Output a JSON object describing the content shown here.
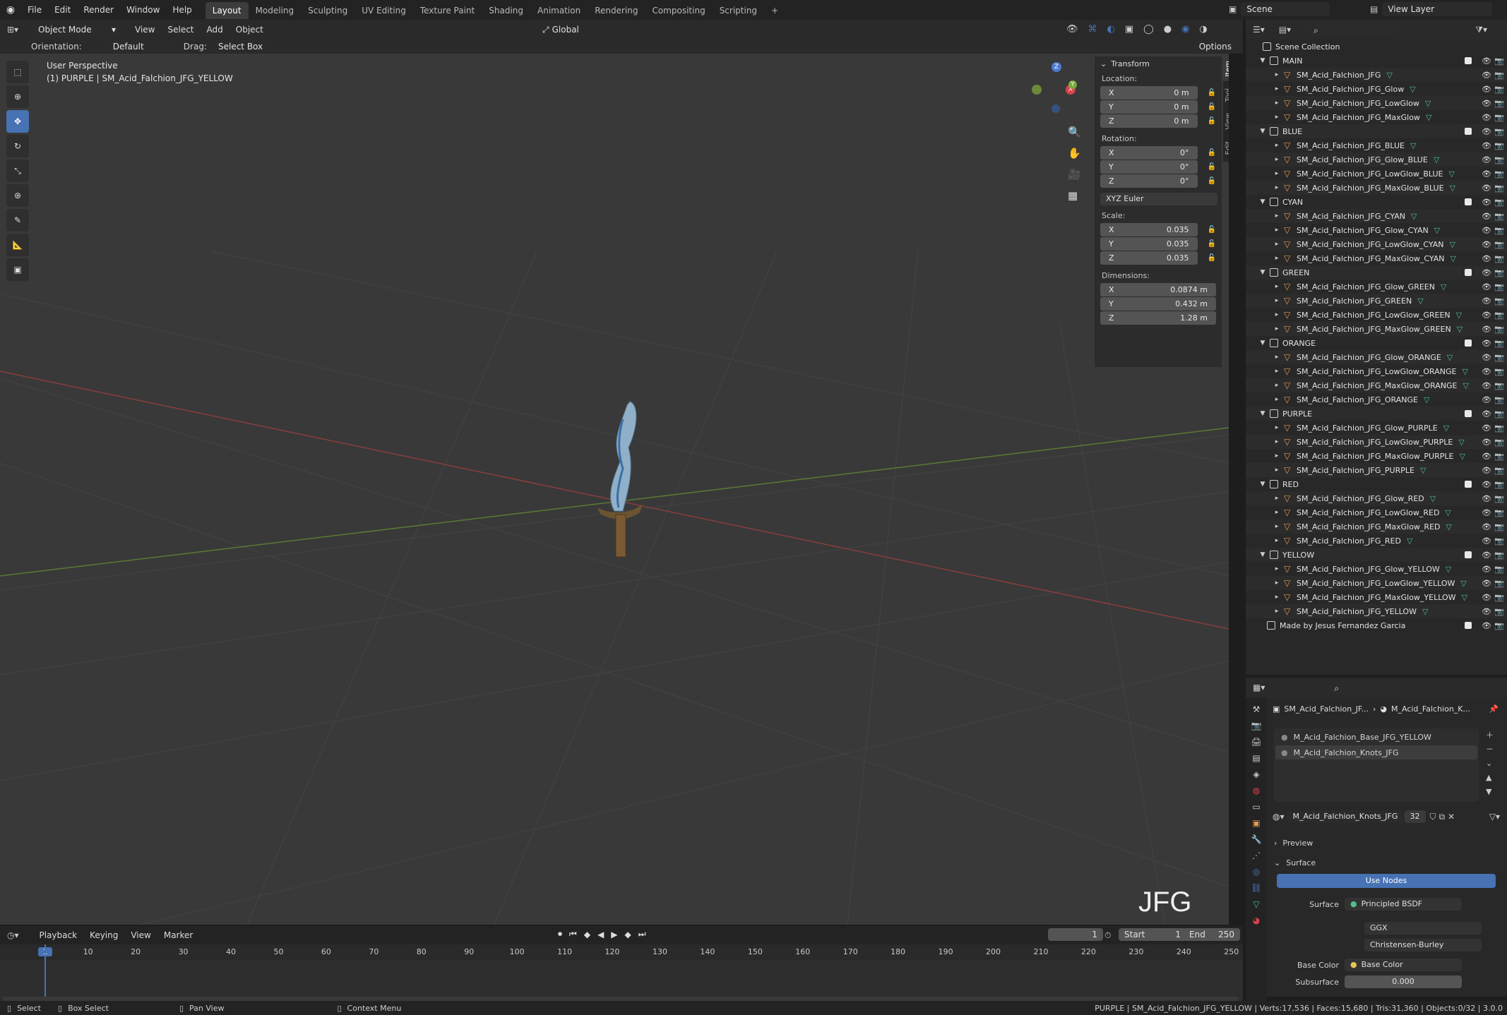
{
  "topbar": {
    "menus": [
      "File",
      "Edit",
      "Render",
      "Window",
      "Help"
    ],
    "workspaces": [
      "Layout",
      "Modeling",
      "Sculpting",
      "UV Editing",
      "Texture Paint",
      "Shading",
      "Animation",
      "Rendering",
      "Compositing",
      "Scripting"
    ],
    "active_workspace": "Layout",
    "add_tab": "+",
    "scene": "Scene",
    "view_layer": "View Layer"
  },
  "viewport_header": {
    "mode": "Object Mode",
    "menus": [
      "View",
      "Select",
      "Add",
      "Object"
    ],
    "transform_orientation": "Global",
    "orientation_label": "Orientation:",
    "orientation_value": "Default",
    "drag_label": "Drag:",
    "drag_value": "Select Box",
    "options": "Options"
  },
  "viewport": {
    "perspective": "User Perspective",
    "object_info": "(1) PURPLE | SM_Acid_Falchion_JFG_YELLOW",
    "watermark": "JFG"
  },
  "gizmo": {
    "x": "X",
    "y": "Y",
    "z": "Z"
  },
  "npanel": {
    "tabs": [
      "Item",
      "Tool",
      "View",
      "Edit"
    ],
    "title": "Transform",
    "location_label": "Location:",
    "location": [
      {
        "axis": "X",
        "value": "0 m"
      },
      {
        "axis": "Y",
        "value": "0 m"
      },
      {
        "axis": "Z",
        "value": "0 m"
      }
    ],
    "rotation_label": "Rotation:",
    "rotation": [
      {
        "axis": "X",
        "value": "0°"
      },
      {
        "axis": "Y",
        "value": "0°"
      },
      {
        "axis": "Z",
        "value": "0°"
      }
    ],
    "rotation_mode": "XYZ Euler",
    "scale_label": "Scale:",
    "scale": [
      {
        "axis": "X",
        "value": "0.035"
      },
      {
        "axis": "Y",
        "value": "0.035"
      },
      {
        "axis": "Z",
        "value": "0.035"
      }
    ],
    "dimensions_label": "Dimensions:",
    "dimensions": [
      {
        "axis": "X",
        "value": "0.0874 m"
      },
      {
        "axis": "Y",
        "value": "0.432 m"
      },
      {
        "axis": "Z",
        "value": "1.28 m"
      }
    ]
  },
  "outliner": {
    "root": "Scene Collection",
    "collections": [
      {
        "name": "MAIN",
        "items": [
          "SM_Acid_Falchion_JFG",
          "SM_Acid_Falchion_JFG_Glow",
          "SM_Acid_Falchion_JFG_LowGlow",
          "SM_Acid_Falchion_JFG_MaxGlow"
        ]
      },
      {
        "name": "BLUE",
        "items": [
          "SM_Acid_Falchion_JFG_BLUE",
          "SM_Acid_Falchion_JFG_Glow_BLUE",
          "SM_Acid_Falchion_JFG_LowGlow_BLUE",
          "SM_Acid_Falchion_JFG_MaxGlow_BLUE"
        ]
      },
      {
        "name": "CYAN",
        "items": [
          "SM_Acid_Falchion_JFG_CYAN",
          "SM_Acid_Falchion_JFG_Glow_CYAN",
          "SM_Acid_Falchion_JFG_LowGlow_CYAN",
          "SM_Acid_Falchion_JFG_MaxGlow_CYAN"
        ]
      },
      {
        "name": "GREEN",
        "items": [
          "SM_Acid_Falchion_JFG_Glow_GREEN",
          "SM_Acid_Falchion_JFG_GREEN",
          "SM_Acid_Falchion_JFG_LowGlow_GREEN",
          "SM_Acid_Falchion_JFG_MaxGlow_GREEN"
        ]
      },
      {
        "name": "ORANGE",
        "items": [
          "SM_Acid_Falchion_JFG_Glow_ORANGE",
          "SM_Acid_Falchion_JFG_LowGlow_ORANGE",
          "SM_Acid_Falchion_JFG_MaxGlow_ORANGE",
          "SM_Acid_Falchion_JFG_ORANGE"
        ]
      },
      {
        "name": "PURPLE",
        "items": [
          "SM_Acid_Falchion_JFG_Glow_PURPLE",
          "SM_Acid_Falchion_JFG_LowGlow_PURPLE",
          "SM_Acid_Falchion_JFG_MaxGlow_PURPLE",
          "SM_Acid_Falchion_JFG_PURPLE"
        ]
      },
      {
        "name": "RED",
        "items": [
          "SM_Acid_Falchion_JFG_Glow_RED",
          "SM_Acid_Falchion_JFG_LowGlow_RED",
          "SM_Acid_Falchion_JFG_MaxGlow_RED",
          "SM_Acid_Falchion_JFG_RED"
        ]
      },
      {
        "name": "YELLOW",
        "items": [
          "SM_Acid_Falchion_JFG_Glow_YELLOW",
          "SM_Acid_Falchion_JFG_LowGlow_YELLOW",
          "SM_Acid_Falchion_JFG_MaxGlow_YELLOW",
          "SM_Acid_Falchion_JFG_YELLOW"
        ]
      }
    ],
    "footer": "Made by Jesus Fernandez Garcia"
  },
  "properties": {
    "breadcrumb_object": "SM_Acid_Falchion_JF...",
    "breadcrumb_material": "M_Acid_Falchion_K...",
    "slots": [
      "M_Acid_Falchion_Base_JFG_YELLOW",
      "M_Acid_Falchion_Knots_JFG"
    ],
    "active_slot": 1,
    "material_name": "M_Acid_Falchion_Knots_JFG",
    "users": "32",
    "preview": "Preview",
    "surface_panel": "Surface",
    "use_nodes": "Use Nodes",
    "surface_label": "Surface",
    "surface_value": "Principled BSDF",
    "distribution": "GGX",
    "subsurface_method": "Christensen-Burley",
    "base_color_label": "Base Color",
    "base_color_value": "Base Color",
    "subsurface_label": "Subsurface",
    "subsurface_value": "0.000"
  },
  "timeline": {
    "menus": [
      "Playback",
      "Keying",
      "View",
      "Marker"
    ],
    "current_frame": "1",
    "start_label": "Start",
    "start": "1",
    "end_label": "End",
    "end": "250",
    "ticks": [
      "1",
      "10",
      "20",
      "30",
      "40",
      "50",
      "60",
      "70",
      "80",
      "90",
      "100",
      "110",
      "120",
      "130",
      "140",
      "150",
      "160",
      "170",
      "180",
      "190",
      "200",
      "210",
      "220",
      "230",
      "240",
      "250"
    ]
  },
  "statusbar": {
    "select": "Select",
    "box_select": "Box Select",
    "pan_view": "Pan View",
    "context_menu": "Context Menu",
    "stats": "PURPLE | SM_Acid_Falchion_JFG_YELLOW | Verts:17,536 | Faces:15,680 | Tris:31,360 | Objects:0/32 | 3.0.0"
  },
  "colors": {
    "accent": "#4772b3",
    "mesh_icon": "#e39b50",
    "x_axis": "#d6434d",
    "y_axis": "#7aa93a",
    "z_axis": "#4e7bd0"
  }
}
